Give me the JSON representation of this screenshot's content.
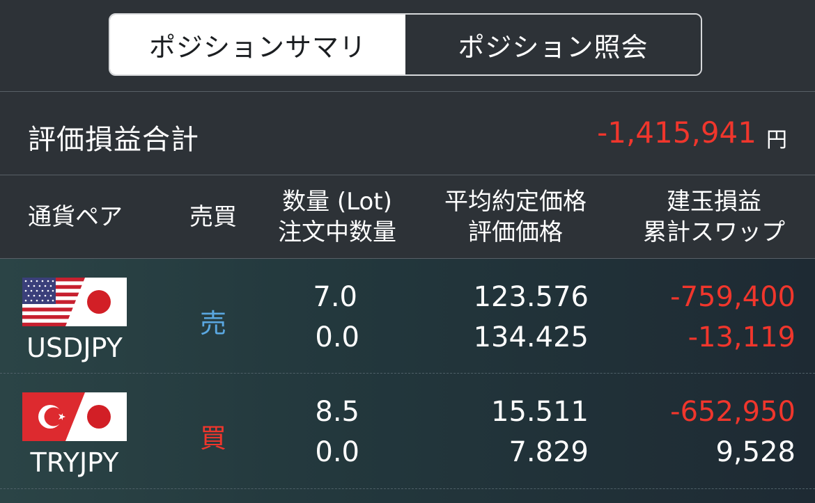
{
  "tabs": [
    {
      "label": "ポジションサマリ",
      "active": true
    },
    {
      "label": "ポジション照会",
      "active": false
    }
  ],
  "total": {
    "label": "評価損益合計",
    "value": "-1,415,941",
    "unit": "円"
  },
  "columns": {
    "pair": "通貨ペア",
    "side": "売買",
    "qty_line1": "数量 (Lot)",
    "qty_line2": "注文中数量",
    "price_line1": "平均約定価格",
    "price_line2": "評価価格",
    "pl_line1": "建玉損益",
    "pl_line2": "累計スワップ"
  },
  "positions": [
    {
      "pair": "USDJPY",
      "flag_icon": "us-jp-flag-icon",
      "side": "売",
      "quantity": "7.0",
      "order_quantity": "0.0",
      "avg_price": "123.576",
      "valuation_price": "134.425",
      "pl": "-759,400",
      "swap": "-13,119"
    },
    {
      "pair": "TRYJPY",
      "flag_icon": "tr-jp-flag-icon",
      "side": "買",
      "quantity": "8.5",
      "order_quantity": "0.0",
      "avg_price": "15.511",
      "valuation_price": "7.829",
      "pl": "-652,950",
      "swap": "9,528"
    }
  ],
  "colors": {
    "background": "#2d3237",
    "negative": "#f0362c",
    "sell": "#5aa7e0",
    "buy": "#f0362c"
  }
}
